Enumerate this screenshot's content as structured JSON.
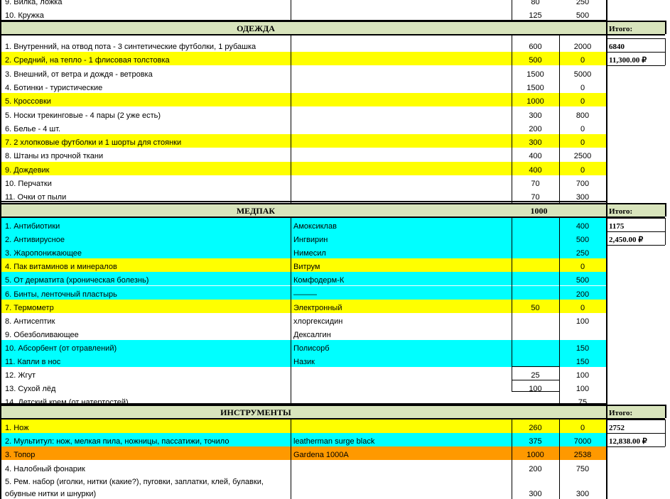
{
  "colors": {
    "yellow": "#ffff00",
    "cyan": "#00ffff",
    "orange": "#ff9900",
    "header_green": "#d8e4bc"
  },
  "rows_top": [
    {
      "name": "9. Вилка, ложка",
      "note": "",
      "weight": "80",
      "price": "250",
      "color": ""
    },
    {
      "name": "10. Кружка",
      "note": "",
      "weight": "125",
      "price": "500",
      "color": ""
    }
  ],
  "sections": [
    {
      "title": "ОДЕЖДА",
      "header_weight": "",
      "itogo_label": "Итого:",
      "total_weight": "6840",
      "total_price": "11,300.00 ₽",
      "rows": [
        {
          "name": "1. Внутренний, на отвод пота - 3 синтетические футболки, 1 рубашка",
          "note": "",
          "weight": "600",
          "price": "2000",
          "color": ""
        },
        {
          "name": "2. Средний, на тепло - 1 флисовая толстовка",
          "note": "",
          "weight": "500",
          "price": "0",
          "color": "yellow"
        },
        {
          "name": "3. Внешний, от ветра и дождя - ветровка",
          "note": "",
          "weight": "1500",
          "price": "5000",
          "color": ""
        },
        {
          "name": "4. Ботинки - туристические",
          "note": "",
          "weight": "1500",
          "price": "0",
          "color": ""
        },
        {
          "name": "5. Кроссовки",
          "note": "",
          "weight": "1000",
          "price": "0",
          "color": "yellow"
        },
        {
          "name": "5. Носки трекинговые - 4 пары (2 уже есть)",
          "note": "",
          "weight": "300",
          "price": "800",
          "color": ""
        },
        {
          "name": "6. Белье - 4 шт.",
          "note": "",
          "weight": "200",
          "price": "0",
          "color": ""
        },
        {
          "name": "7. 2 хлопковые футболки и 1 шорты для стоянки",
          "note": "",
          "weight": "300",
          "price": "0",
          "color": "yellow"
        },
        {
          "name": "8. Штаны из прочной ткани",
          "note": "",
          "weight": "400",
          "price": "2500",
          "color": ""
        },
        {
          "name": "9. Дождевик",
          "note": "",
          "weight": "400",
          "price": "0",
          "color": "yellow"
        },
        {
          "name": "10. Перчатки",
          "note": "",
          "weight": "70",
          "price": "700",
          "color": ""
        },
        {
          "name": "11. Очки от пыли",
          "note": "",
          "weight": "70",
          "price": "300",
          "color": ""
        }
      ]
    },
    {
      "title": "МЕДПАК",
      "header_weight": "1000",
      "itogo_label": "Итого:",
      "total_weight": "1175",
      "total_price": "2,450.00 ₽",
      "rows": [
        {
          "name": "1. Антибиотики",
          "note": "Амоксиклав",
          "weight": "",
          "price": "400",
          "color": "cyan"
        },
        {
          "name": "2. Антивирусное",
          "note": "Ингвирин",
          "weight": "",
          "price": "500",
          "color": "cyan"
        },
        {
          "name": "3. Жаропонижающее",
          "note": "Нимесил",
          "weight": "",
          "price": "250",
          "color": "cyan"
        },
        {
          "name": "4. Пак витаминов и минералов",
          "note": "Витрум",
          "weight": "",
          "price": "0",
          "color": "yellow"
        },
        {
          "name": "5. От дерматита (хроническая болезнь)",
          "note": "Комфодерм-К",
          "weight": "",
          "price": "500",
          "color": "cyan"
        },
        {
          "name": "6. Бинты, ленточный пластырь",
          "note": "———",
          "weight": "",
          "price": "200",
          "color": "cyan"
        },
        {
          "name": "7. Термометр",
          "note": "Электронный",
          "weight": "50",
          "price": "0",
          "color": "yellow"
        },
        {
          "name": "8. Антисептик",
          "note": "хлоргексидин",
          "weight": "",
          "price": "100",
          "color": ""
        },
        {
          "name": "9.  Обезболивающее",
          "note": "Дексалгин",
          "weight": "",
          "price": "",
          "color": ""
        },
        {
          "name": "10. Абсорбент (от отравлений)",
          "note": "Полисорб",
          "weight": "",
          "price": "150",
          "color": "cyan"
        },
        {
          "name": "11. Капли в нос",
          "note": "Назик",
          "weight": "",
          "price": "150",
          "color": "cyan"
        },
        {
          "name": "12. Жгут",
          "note": "",
          "weight": "25",
          "price": "100",
          "color": ""
        },
        {
          "name": "13. Сухой лёд",
          "note": "",
          "weight": "100",
          "price": "100",
          "color": ""
        },
        {
          "name": "14. Детский крем (от натертостей)",
          "note": "",
          "weight": "",
          "price": "75",
          "color": ""
        }
      ]
    },
    {
      "title": "ИНСТРУМЕНТЫ",
      "header_weight": "",
      "itogo_label": "Итого:",
      "total_weight": "2752",
      "total_price": "12,838.00 ₽",
      "rows": [
        {
          "name": "1. Нож",
          "note": "",
          "weight": "260",
          "price": "0",
          "color": "yellow"
        },
        {
          "name": "2. Мультитул: нож, мелкая пила, ножницы, пассатижи, точило",
          "note": "leatherman surge black",
          "weight": "375",
          "price": "7000",
          "color": "cyan"
        },
        {
          "name": "3. Топор",
          "note": "Gardena 1000A",
          "weight": "1000",
          "price": "2538",
          "color": "orange"
        },
        {
          "name": "4. Налобный фонарик",
          "note": "",
          "weight": "200",
          "price": "750",
          "color": ""
        },
        {
          "name": "5. Рем. набор (иголки, нитки (какие?), пуговки, заплатки, клей, булавки,",
          "name2": "обувные нитки и шнурки)",
          "note": "",
          "weight": "300",
          "price": "300",
          "color": ""
        }
      ]
    }
  ]
}
